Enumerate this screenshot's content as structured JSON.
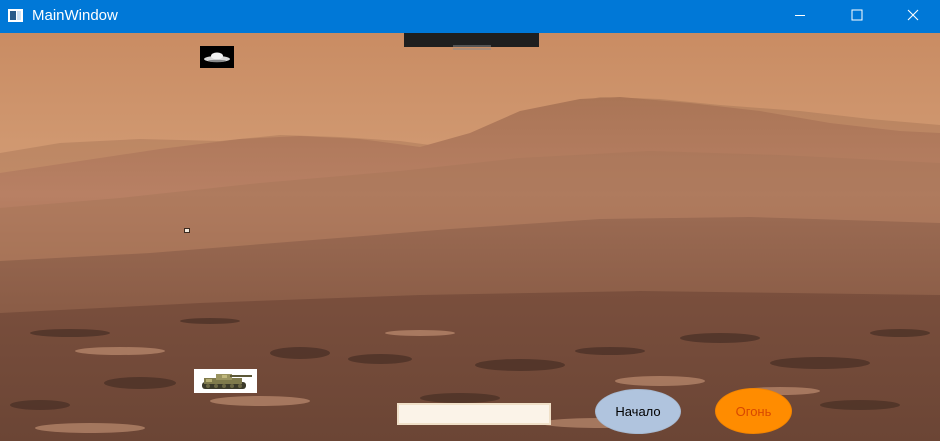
{
  "window": {
    "title": "MainWindow",
    "titlebar_color": "#0078d7",
    "controls": {
      "minimize_icon": "minimize-icon",
      "maximize_icon": "maximize-icon",
      "close_icon": "close-icon"
    }
  },
  "scene": {
    "background": "mars-landscape",
    "sprites": {
      "ufo": "ufo-sprite",
      "tank": "tank-sprite",
      "projectile": "projectile"
    }
  },
  "controls": {
    "input_value": "",
    "start_label": "Начало",
    "fire_label": "Огонь",
    "start_color": "#b0c4de",
    "fire_color": "#ff8c00"
  }
}
